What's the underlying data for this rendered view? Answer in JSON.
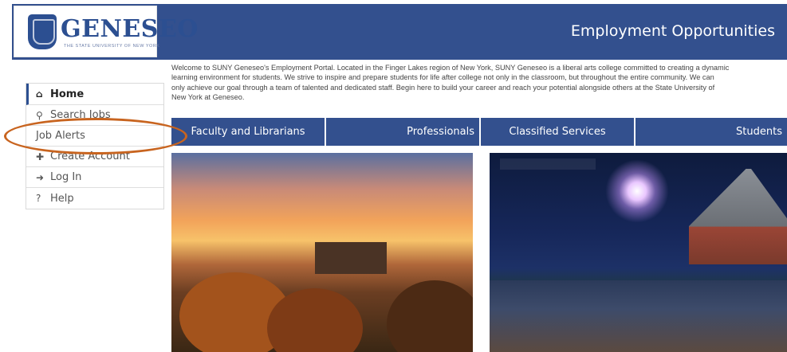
{
  "header": {
    "logo_text": "GENESEO",
    "logo_subtitle": "THE STATE UNIVERSITY OF NEW YORK",
    "title": "Employment Opportunities"
  },
  "intro": {
    "lines": [
      "Welcome to SUNY Geneseo's Employment Portal. Located in the Finger Lakes region of New York, SUNY Geneseo is a liberal arts college committed to creating a dynamic",
      "learning environment for students. We strive to inspire and prepare students for life after college not only in the classroom, but throughout the entire community. We can",
      "only achieve our goal through a team of talented and dedicated staff. Begin here to build your career and reach your potential alongside others at the State University of",
      "New York at Geneseo."
    ]
  },
  "sidebar": {
    "items": [
      {
        "label": "Home",
        "icon": "home-icon",
        "glyph": "⌂"
      },
      {
        "label": "Search Jobs",
        "icon": "search-icon",
        "glyph": "⚲"
      },
      {
        "label": "Job Alerts",
        "icon": "",
        "glyph": ""
      },
      {
        "label": "Create Account",
        "icon": "plus-icon",
        "glyph": "✚"
      },
      {
        "label": "Log In",
        "icon": "login-icon",
        "glyph": "➜"
      },
      {
        "label": "Help",
        "icon": "help-icon",
        "glyph": "?"
      }
    ]
  },
  "tabs": [
    "Faculty and Librarians",
    "Professionals",
    "Classified Services",
    "Students"
  ],
  "colors": {
    "brand_blue": "#33508e",
    "annotation_orange": "#c8641f"
  }
}
